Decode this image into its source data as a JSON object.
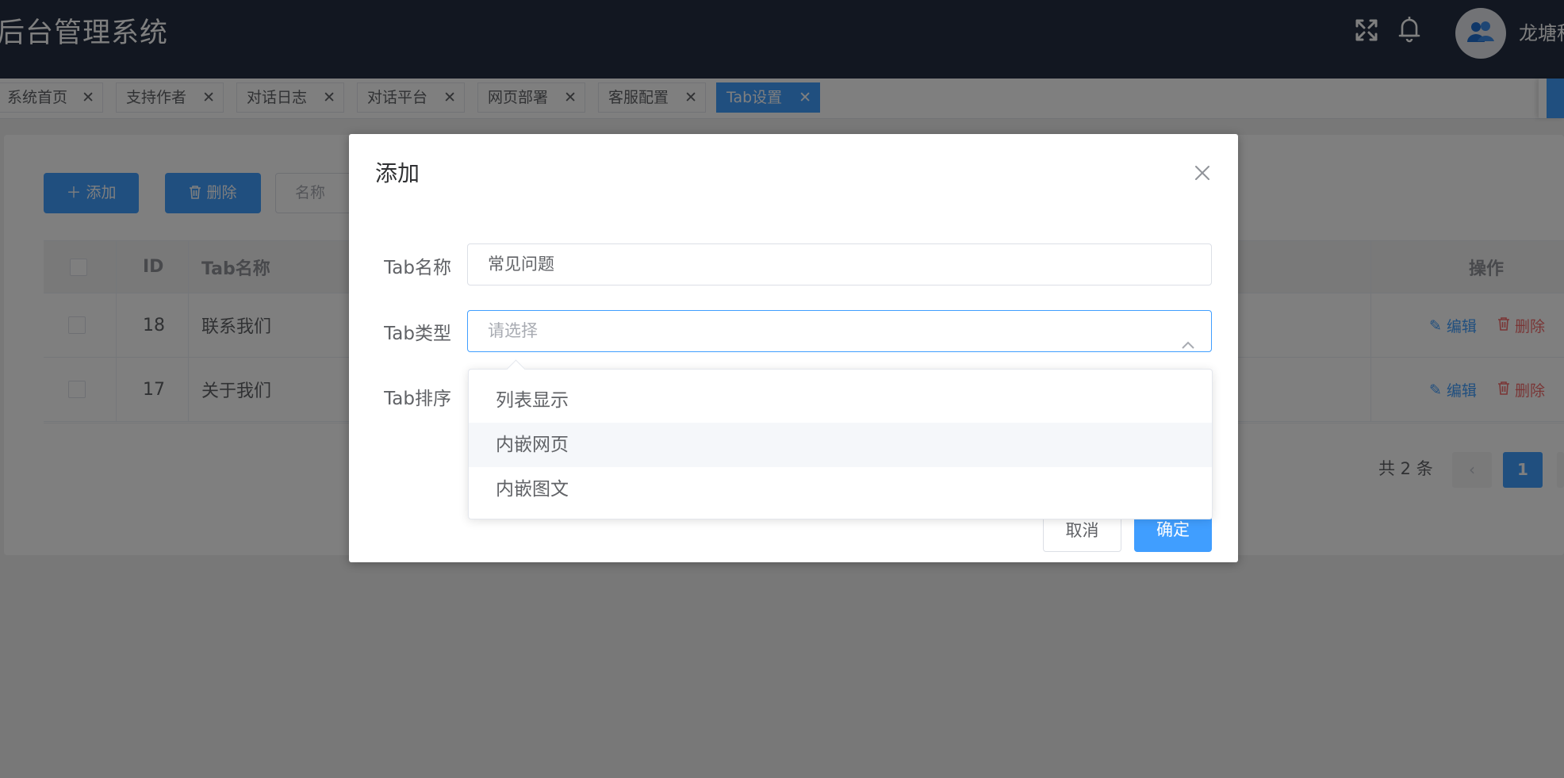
{
  "header": {
    "title": "后台管理系统",
    "username": "龙塘科",
    "icons": [
      "fullscreen-icon",
      "bell-icon",
      "user-group-icon"
    ]
  },
  "tabs": [
    {
      "label": "系统首页"
    },
    {
      "label": "支持作者"
    },
    {
      "label": "对话日志"
    },
    {
      "label": "对话平台"
    },
    {
      "label": "网页部署"
    },
    {
      "label": "客服配置"
    },
    {
      "label": "Tab设置",
      "active": true
    }
  ],
  "toolbar": {
    "add_label": "添加",
    "delete_label": "删除",
    "search_placeholder": "名称"
  },
  "table": {
    "columns": {
      "id": "ID",
      "name": "Tab名称",
      "actions": "操作"
    },
    "rows": [
      {
        "id": "18",
        "name": "联系我们",
        "edit": "编辑",
        "delete": "删除"
      },
      {
        "id": "17",
        "name": "关于我们",
        "edit": "编辑",
        "delete": "删除"
      }
    ]
  },
  "pagination": {
    "total": "共 2 条",
    "current": "1"
  },
  "dialog": {
    "title": "添加",
    "fields": {
      "name_label": "Tab名称",
      "name_value": "常见问题",
      "type_label": "Tab类型",
      "type_placeholder": "请选择",
      "order_label": "Tab排序"
    },
    "footer": {
      "cancel_label": "取消",
      "confirm_label": "确定"
    }
  },
  "dropdown": {
    "options": [
      "列表显示",
      "内嵌网页",
      "内嵌图文"
    ],
    "hovered_index": 1
  },
  "colors": {
    "header_bg": "#242f42",
    "primary": "#409eff",
    "danger": "#f56c6c"
  }
}
